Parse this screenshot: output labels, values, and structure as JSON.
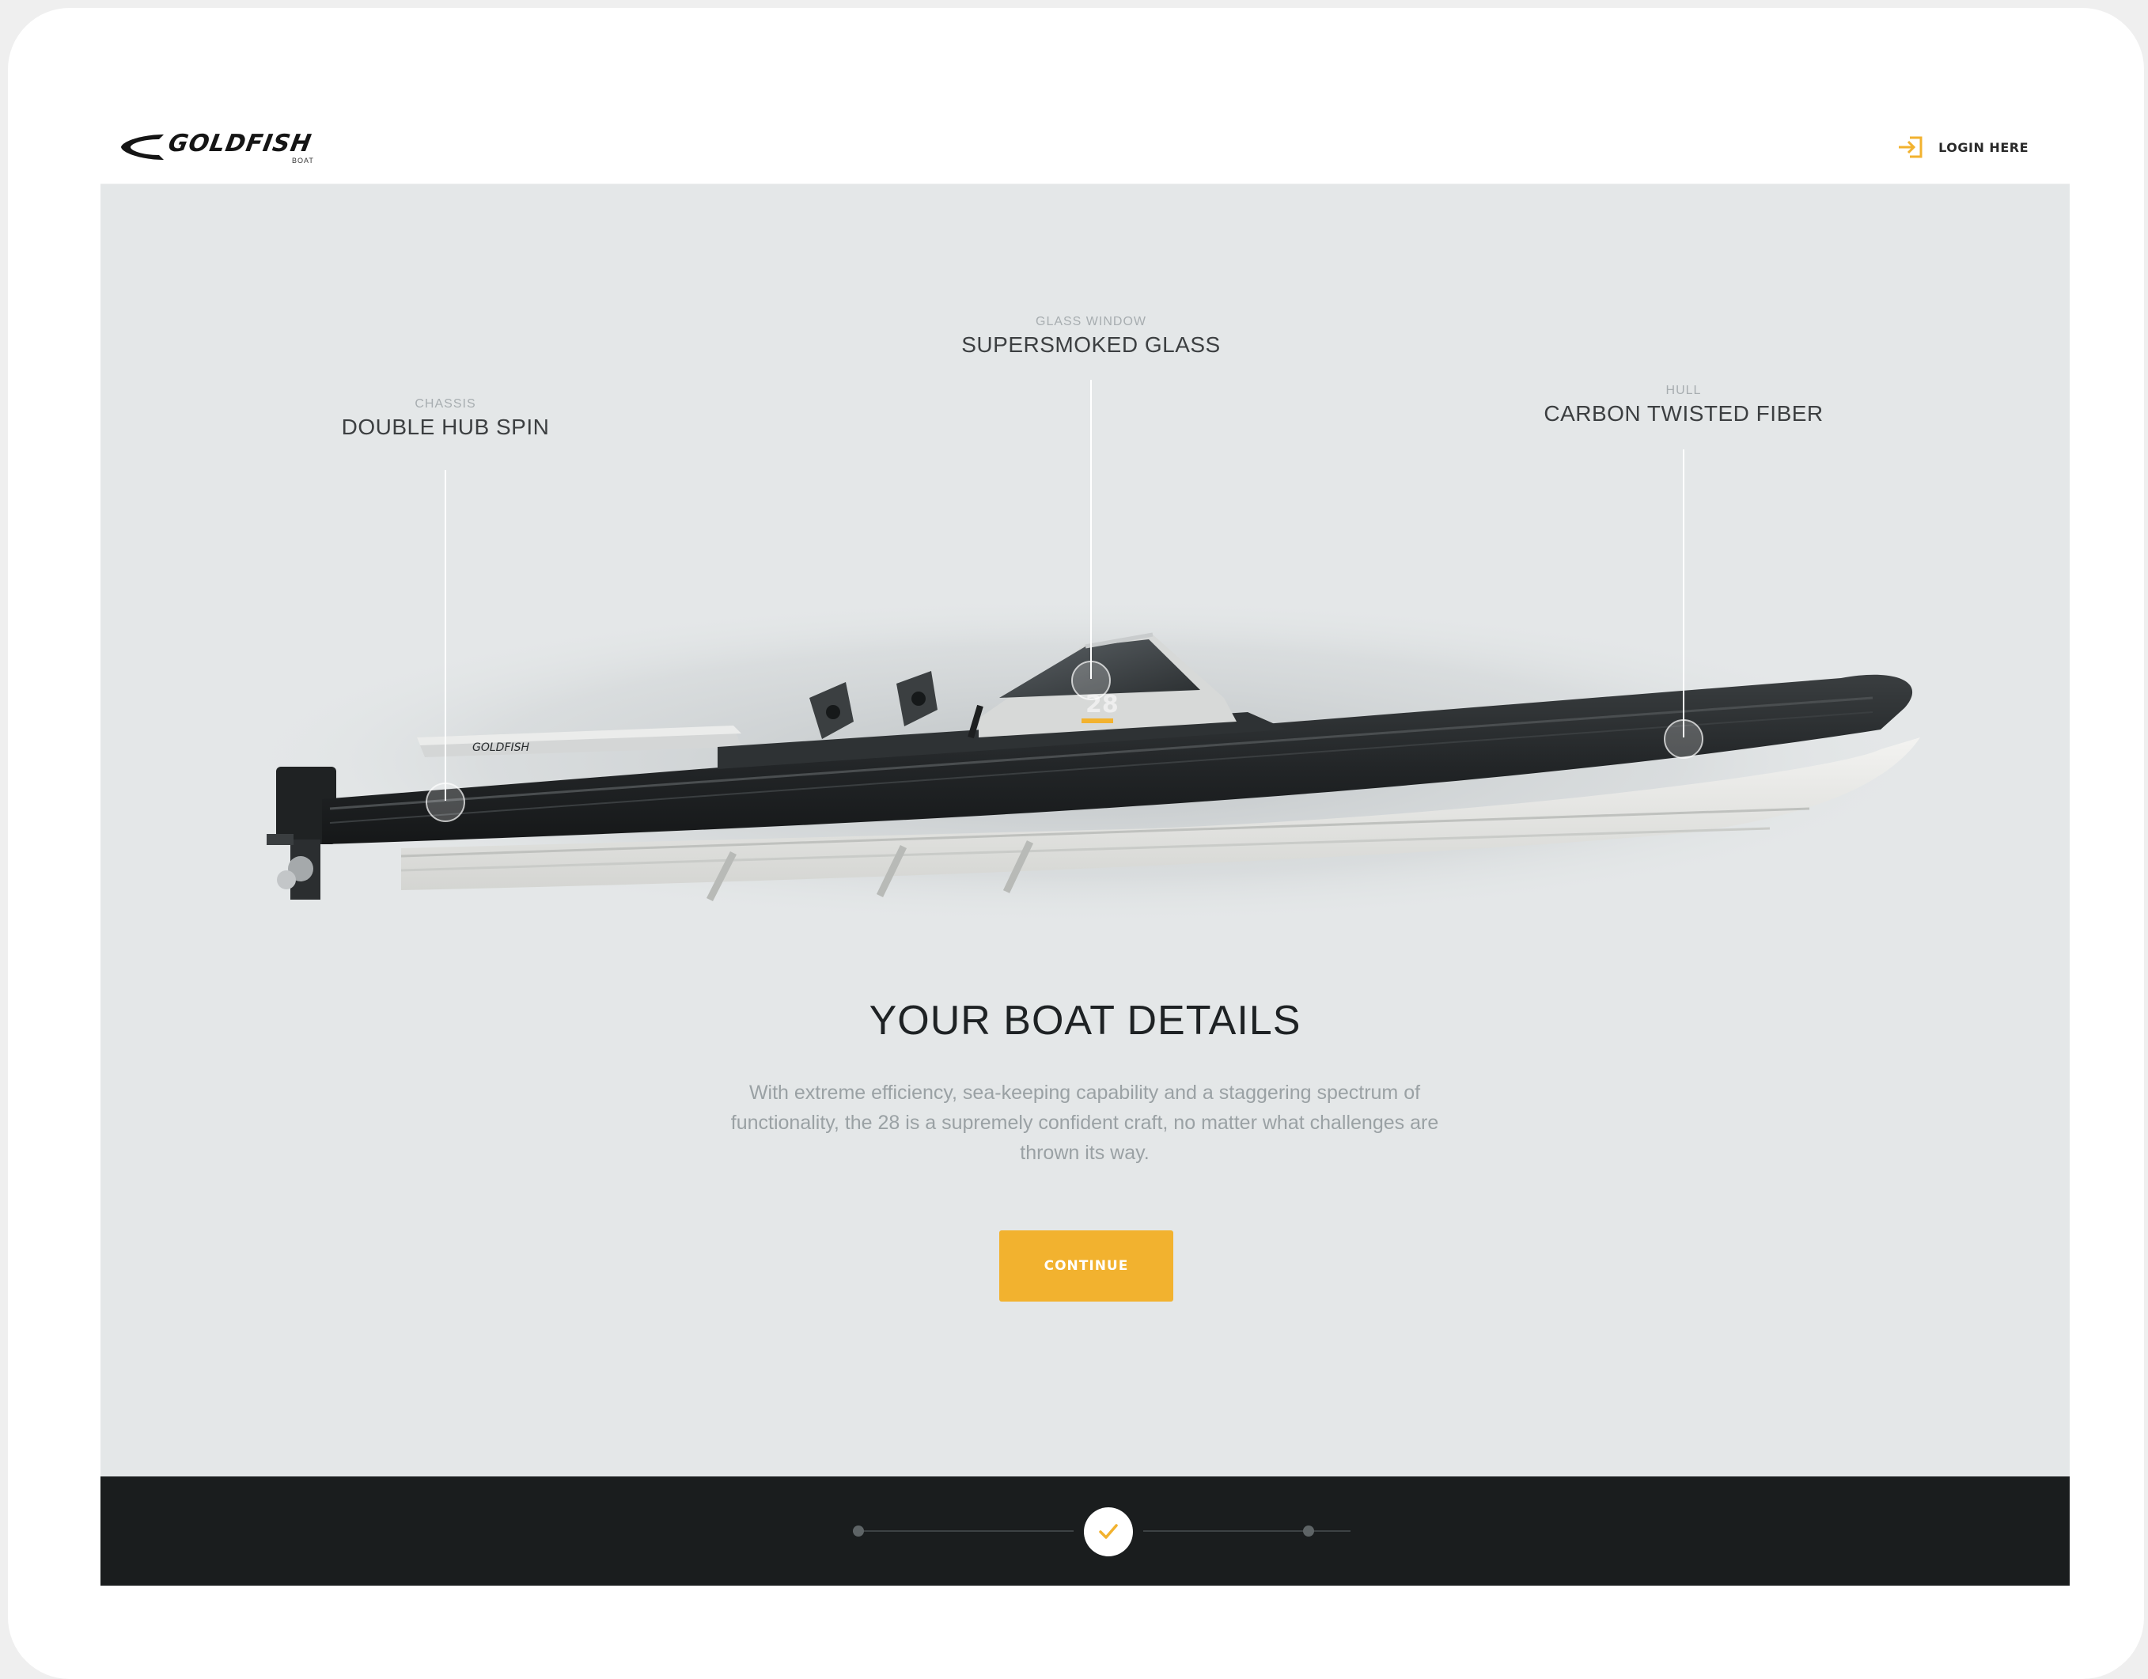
{
  "brand": {
    "name": "GOLDFISH",
    "sub": "BOAT"
  },
  "header": {
    "login_label": "LOGIN HERE",
    "login_icon": "login-icon"
  },
  "callouts": [
    {
      "category": "CHASSIS",
      "value": "DOUBLE HUB SPIN"
    },
    {
      "category": "GLASS WINDOW",
      "value": "SUPERSMOKED GLASS"
    },
    {
      "category": "HULL",
      "value": "CARBON TWISTED FIBER"
    }
  ],
  "boat": {
    "hull_mark": "GOLDFISH",
    "model_number": "28"
  },
  "content": {
    "title": "YOUR BOAT DETAILS",
    "description": "With extreme efficiency, sea-keeping capability and a staggering spectrum of functionality, the 28 is a supremely confident craft, no matter what challenges are thrown its way.",
    "cta_label": "CONTINUE"
  },
  "progress": {
    "total_steps": 3,
    "current_step": 2,
    "current_icon": "check-icon"
  },
  "colors": {
    "accent": "#f2b22f",
    "page_background": "#e4e7e8",
    "footer": "#1a1d1e",
    "tube": "#26292b",
    "hull": "#e9e9e6"
  }
}
